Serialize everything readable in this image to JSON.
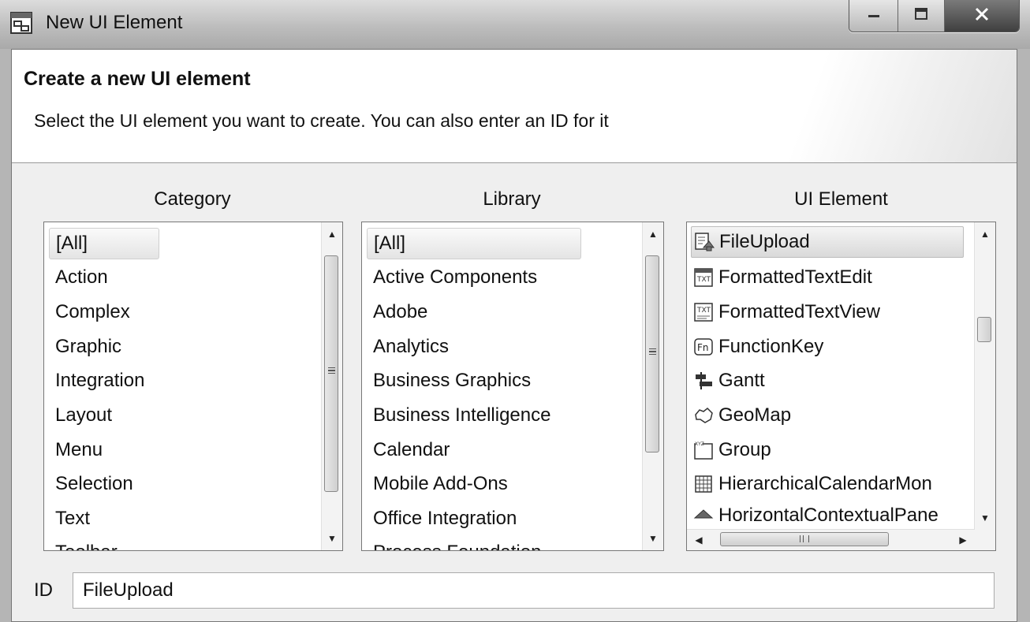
{
  "window": {
    "title": "New UI Element",
    "icon": "ui-element-icon",
    "controls": [
      "minimize-icon",
      "maximize-icon",
      "close-icon"
    ]
  },
  "header": {
    "title": "Create a new UI element",
    "subtitle": "Select the UI element you want to create. You can also enter an ID for it"
  },
  "category": {
    "label": "Category",
    "selected": "[All]",
    "items": [
      "[All]",
      "Action",
      "Complex",
      "Graphic",
      "Integration",
      "Layout",
      "Menu",
      "Selection",
      "Text",
      "Toolbar"
    ]
  },
  "library": {
    "label": "Library",
    "selected": "[All]",
    "items": [
      "[All]",
      "Active Components",
      "Adobe",
      "Analytics",
      "Business Graphics",
      "Business Intelligence",
      "Calendar",
      "Mobile Add-Ons",
      "Office Integration",
      "Process Foundation"
    ]
  },
  "ui_element": {
    "label": "UI Element",
    "selected": "FileUpload",
    "items": [
      {
        "label": "FileUpload",
        "icon": "file-upload-icon"
      },
      {
        "label": "FormattedTextEdit",
        "icon": "formatted-text-edit-icon"
      },
      {
        "label": "FormattedTextView",
        "icon": "formatted-text-view-icon"
      },
      {
        "label": "FunctionKey",
        "icon": "function-key-icon"
      },
      {
        "label": "Gantt",
        "icon": "gantt-icon"
      },
      {
        "label": "GeoMap",
        "icon": "geomap-icon"
      },
      {
        "label": "Group",
        "icon": "group-icon"
      },
      {
        "label": "HierarchicalCalendarMon",
        "icon": "calendar-icon"
      },
      {
        "label": "HorizontalContextualPane",
        "icon": "contextual-panel-icon"
      }
    ]
  },
  "id_field": {
    "label": "ID",
    "value": "FileUpload"
  }
}
